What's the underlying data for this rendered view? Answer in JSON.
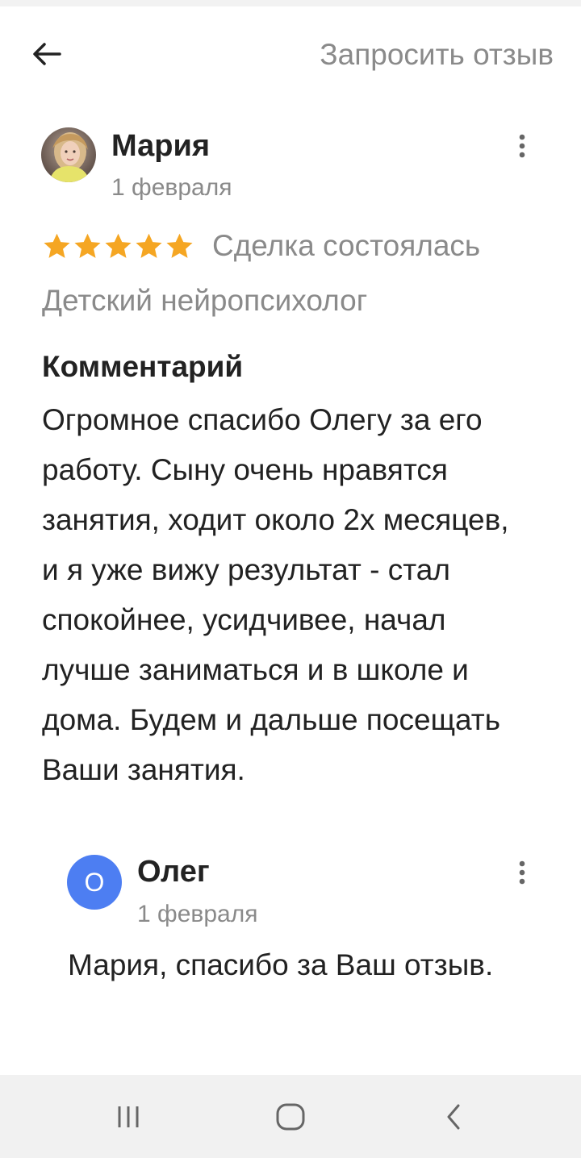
{
  "header": {
    "back_icon": "arrow-left-icon",
    "request_review_label": "Запросить отзыв"
  },
  "review": {
    "author_name": "Мария",
    "date": "1 февраля",
    "rating": 5,
    "rating_max": 5,
    "deal_status": "Сделка состоялась",
    "service": "Детский нейропсихолог",
    "comment_heading": "Комментарий",
    "comment_text": "Огромное спасибо Олегу за его работу. Сыну очень нравятся занятия, ходит около 2х месяцев, и я уже вижу результат - стал спокойнее, усидчивее, начал лучше заниматься и в школе и дома. Будем и дальше посещать Ваши занятия.",
    "star_color": "#f5a623",
    "menu_icon": "more-vertical-icon"
  },
  "reply": {
    "avatar_letter": "О",
    "avatar_color": "#4d7ef2",
    "author_name": "Олег",
    "date": "1 февраля",
    "text": "Мария, спасибо за Ваш отзыв.",
    "menu_icon": "more-vertical-icon"
  },
  "system_nav": {
    "recents_icon": "recent-apps-icon",
    "home_icon": "home-icon",
    "back_icon": "back-chevron-icon"
  }
}
